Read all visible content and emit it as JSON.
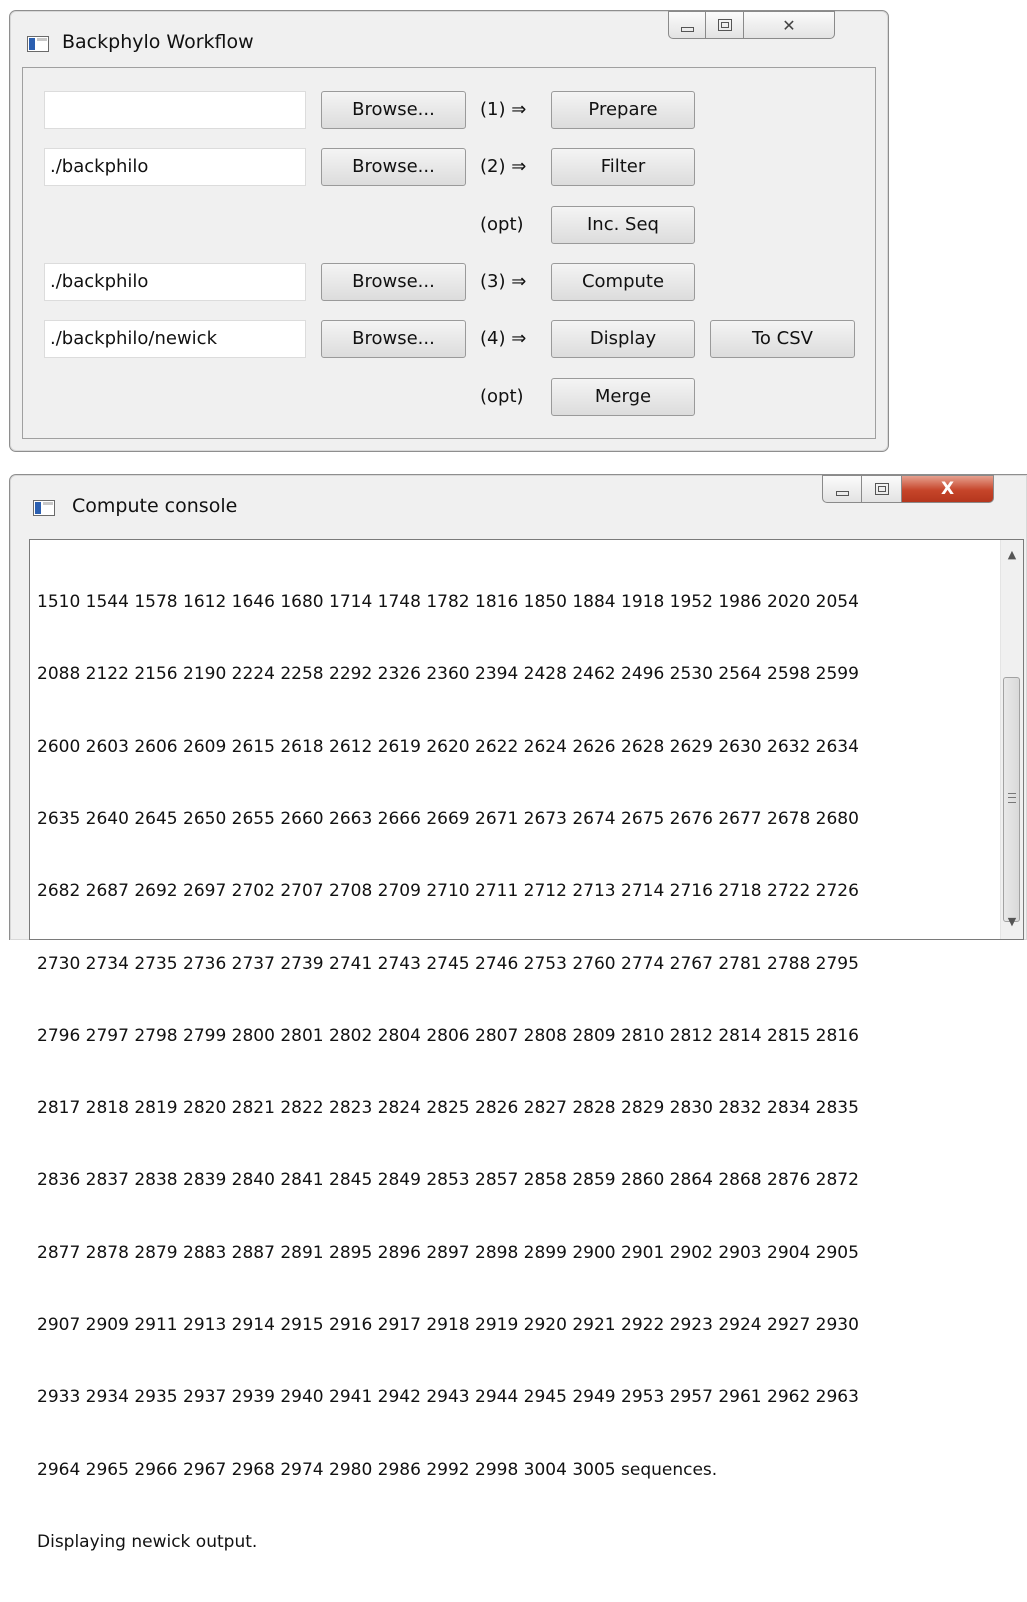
{
  "workflow": {
    "title": "Backphylo Workflow",
    "rows": [
      {
        "path_value": "",
        "browse_label": "Browse...",
        "step": "(1) ⇒",
        "action_label": "Prepare"
      },
      {
        "path_value": "./backphilo",
        "browse_label": "Browse...",
        "step": "(2) ⇒",
        "action_label": "Filter"
      },
      {
        "step": "(opt)",
        "action_label": "Inc. Seq"
      },
      {
        "path_value": "./backphilo",
        "browse_label": "Browse...",
        "step": "(3) ⇒",
        "action_label": "Compute"
      },
      {
        "path_value": "./backphilo/newick",
        "browse_label": "Browse...",
        "step": "(4) ⇒",
        "action_label": "Display",
        "extra_label": "To CSV"
      },
      {
        "step": "(opt)",
        "action_label": "Merge"
      }
    ]
  },
  "console": {
    "title": "Compute console",
    "lines": [
      "1510 1544 1578 1612 1646 1680 1714 1748 1782 1816 1850 1884 1918 1952 1986 2020 2054",
      "2088 2122 2156 2190 2224 2258 2292 2326 2360 2394 2428 2462 2496 2530 2564 2598 2599",
      "2600 2603 2606 2609 2615 2618 2612 2619 2620 2622 2624 2626 2628 2629 2630 2632 2634",
      "2635 2640 2645 2650 2655 2660 2663 2666 2669 2671 2673 2674 2675 2676 2677 2678 2680",
      "2682 2687 2692 2697 2702 2707 2708 2709 2710 2711 2712 2713 2714 2716 2718 2722 2726",
      "2730 2734 2735 2736 2737 2739 2741 2743 2745 2746 2753 2760 2774 2767 2781 2788 2795",
      "2796 2797 2798 2799 2800 2801 2802 2804 2806 2807 2808 2809 2810 2812 2814 2815 2816",
      "2817 2818 2819 2820 2821 2822 2823 2824 2825 2826 2827 2828 2829 2830 2832 2834 2835",
      "2836 2837 2838 2839 2840 2841 2845 2849 2853 2857 2858 2859 2860 2864 2868 2876 2872",
      "2877 2878 2879 2883 2887 2891 2895 2896 2897 2898 2899 2900 2901 2902 2903 2904 2905",
      "2907 2909 2911 2913 2914 2915 2916 2917 2918 2919 2920 2921 2922 2923 2924 2927 2930",
      "2933 2934 2935 2937 2939 2940 2941 2942 2943 2944 2945 2949 2953 2957 2961 2962 2963",
      "2964 2965 2966 2967 2968 2974 2980 2986 2992 2998 3004 3005 sequences.",
      "Displaying newick output."
    ]
  },
  "icons": {
    "app_icon": "window-app-icon",
    "minimize": "minimize-icon",
    "maximize": "maximize-icon",
    "close": "close-icon",
    "scroll_up": "scroll-up-arrow-icon",
    "scroll_down": "scroll-down-arrow-icon"
  },
  "colors": {
    "window_bg": "#f0f0f0",
    "close_active": "#c6452a"
  }
}
